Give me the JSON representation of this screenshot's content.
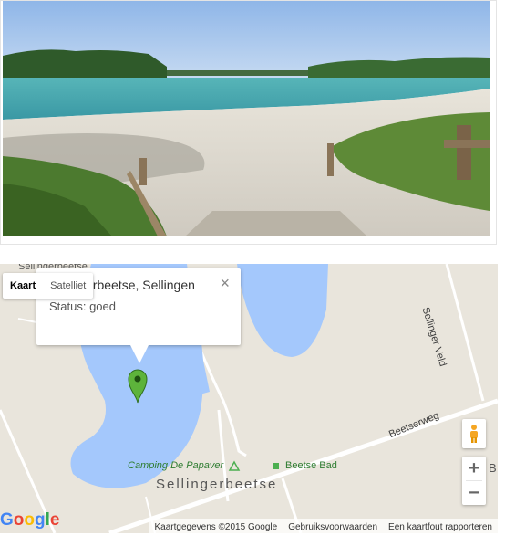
{
  "photo": {
    "scene": "lake-beach-photo"
  },
  "map": {
    "type_control": {
      "map_label": "Kaart",
      "satellite_label": "Satelliet",
      "active": "Kaart"
    },
    "info_window": {
      "title": "Sellingerbeetse, Sellingen",
      "status": "Status: goed",
      "close_icon": "close-icon"
    },
    "labels": {
      "top_place": "Sellingerbeetse",
      "road_selinger_veld": "Sellinger Veld",
      "road_beetserweg": "Beetserweg",
      "camping": "Camping De Papaver",
      "beetse_bad": "Beetse Bad",
      "town": "Sellingerbeetse",
      "edge_letter": "B"
    },
    "zoom": {
      "in": "+",
      "out": "−"
    },
    "logo": "Google",
    "attribution": {
      "data": "Kaartgegevens ©2015 Google",
      "terms": "Gebruiksvoorwaarden",
      "report": "Een kaartfout rapporteren"
    },
    "colors": {
      "water": "#a4c8fc",
      "land": "#e9e5dc",
      "marker": "#5db33b"
    }
  }
}
